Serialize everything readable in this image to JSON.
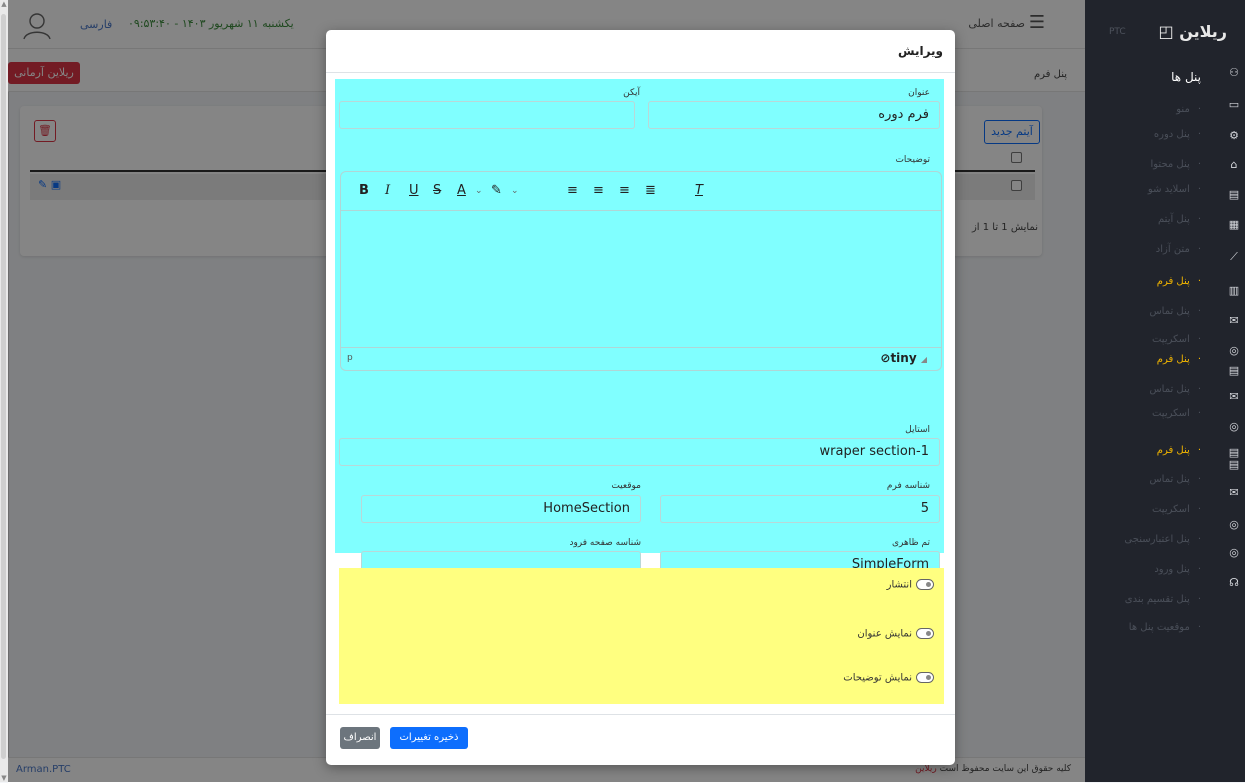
{
  "topbar": {
    "language": "فارسی",
    "datetime": "یکشنبه ۱۱ شهریور ۱۴۰۳ - ۰۹:۵۳:۴۰",
    "home": "صفحه اصلی",
    "menu_icon": "hamburger-icon"
  },
  "subbar": {
    "arman_button": "ریلاین آرمانی",
    "breadcrumb": "پنل فرم"
  },
  "card": {
    "new_item": "آیتم جدید",
    "showing": "نمایش 1 تا 1 از"
  },
  "sidebar": {
    "brand": "ریلاین",
    "brand_sub": "PTC",
    "title": "پنل ها",
    "items": [
      {
        "label": "منو",
        "active": false
      },
      {
        "label": "پنل دوره",
        "active": false
      },
      {
        "label": "پنل محتوا",
        "active": false
      },
      {
        "label": "اسلاید شو",
        "active": false
      },
      {
        "label": "پنل آیتم",
        "active": false
      },
      {
        "label": "متن آزاد",
        "active": false
      },
      {
        "label": "پنل فرم",
        "active": true
      },
      {
        "label": "پنل تماس",
        "active": false
      },
      {
        "label": "اسکریپت",
        "active": false
      },
      {
        "label": "پنل فرم",
        "active": true
      },
      {
        "label": "پنل تماس",
        "active": false
      },
      {
        "label": "اسکریپت",
        "active": false
      },
      {
        "label": "پنل فرم",
        "active": true
      },
      {
        "label": "پنل تماس",
        "active": false
      },
      {
        "label": "اسکریپت",
        "active": false
      },
      {
        "label": "پنل اعتبارسنجی",
        "active": false
      },
      {
        "label": "پنل ورود",
        "active": false
      },
      {
        "label": "پنل تقسیم بندی",
        "active": false
      },
      {
        "label": "موقعیت پنل ها",
        "active": false
      }
    ]
  },
  "footer": {
    "left": "Arman.PTC",
    "right_prefix": "کلیه حقوق این سایت محفوظ است",
    "right_link": "ریلاین"
  },
  "modal": {
    "title": "ویرایش",
    "fields": {
      "title_label": "عنوان",
      "title_value": "فرم دوره",
      "icon_label": "آیکن",
      "icon_value": "",
      "description_label": "توضیحات",
      "style_label": "استایل",
      "style_value": "wraper section-1",
      "form_id_label": "شناسه فرم",
      "form_id_value": "5",
      "position_label": "موقعیت",
      "position_value": "HomeSection",
      "theme_label": "تم ظاهری",
      "theme_value": "SimpleForm",
      "landing_id_label": "شناسه صفحه فرود",
      "landing_id_value": ""
    },
    "editor": {
      "status_path": "p",
      "brand": "tiny"
    },
    "toggles": {
      "publish": "انتشار",
      "show_title": "نمایش عنوان",
      "show_description": "نمایش توضیحات"
    },
    "buttons": {
      "save": "ذخیره تغییرات",
      "cancel": "انصراف"
    }
  },
  "colors": {
    "cyan_panel": "#80ffff",
    "yellow_panel": "#ffff80",
    "sidebar_bg": "#21242c",
    "active_item": "#f0b400",
    "primary": "#0d6efd",
    "danger": "#dc3545"
  }
}
